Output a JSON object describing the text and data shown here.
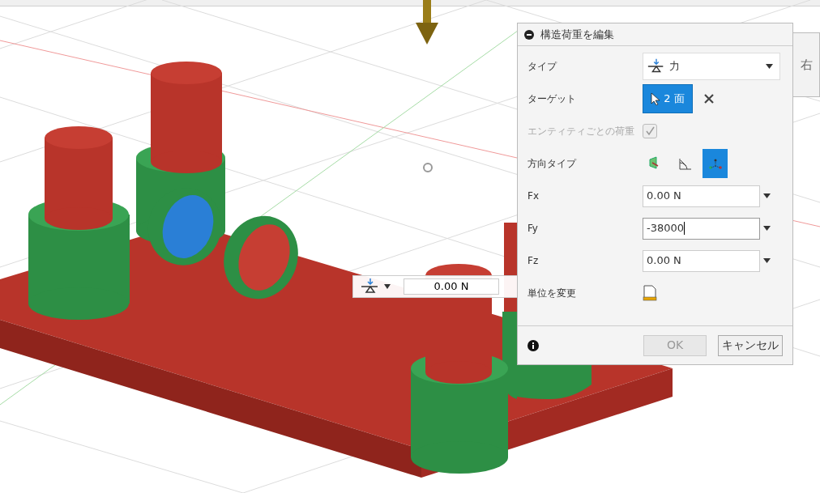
{
  "view_cube": {
    "label": "右"
  },
  "hud": {
    "value": "0.00 N"
  },
  "dialog": {
    "title": "構造荷重を編集",
    "rows": [
      {
        "kind": "dropdown",
        "label": "タイプ",
        "value": "力"
      },
      {
        "kind": "selection",
        "label": "ターゲット",
        "value": "2 面"
      },
      {
        "kind": "checkbox",
        "label": "エンティティごとの荷重",
        "disabled": true,
        "checked": true
      },
      {
        "kind": "direction",
        "label": "方向タイプ",
        "options": [
          {
            "selected": false
          },
          {
            "selected": false
          },
          {
            "selected": true
          }
        ]
      },
      {
        "kind": "input",
        "label": "Fx",
        "value": "0.00 N",
        "focused": false
      },
      {
        "kind": "input",
        "label": "Fy",
        "value": "-38000",
        "focused": true
      },
      {
        "kind": "input",
        "label": "Fz",
        "value": "0.00 N",
        "focused": false
      },
      {
        "kind": "units",
        "label": "単位を変更"
      }
    ],
    "buttons": [
      {
        "label": "OK",
        "disabled": true
      },
      {
        "label": "キャンセル",
        "disabled": false
      }
    ]
  }
}
